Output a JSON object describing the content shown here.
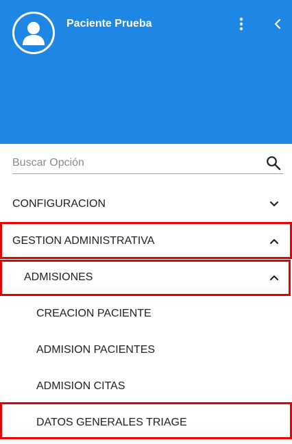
{
  "header": {
    "user_name": "Paciente Prueba",
    "background_color": "#1e86e5",
    "avatar_icon": "user-avatar-icon",
    "more_icon": "more-vertical-icon",
    "collapse_icon": "chevron-left-icon"
  },
  "search": {
    "placeholder": "Buscar Opción",
    "value": "",
    "icon": "search-icon"
  },
  "menu": {
    "configuracion": {
      "label": "CONFIGURACION",
      "state": "collapsed"
    },
    "gestion": {
      "label": "GESTION ADMINISTRATIVA",
      "state": "expanded"
    },
    "admisiones": {
      "label": "ADMISIONES",
      "state": "expanded"
    },
    "creacion_paciente": {
      "label": "CREACION PACIENTE"
    },
    "admision_pacientes": {
      "label": "ADMISION PACIENTES"
    },
    "admision_citas": {
      "label": "ADMISION CITAS"
    },
    "datos_triage": {
      "label": "DATOS GENERALES TRIAGE"
    }
  },
  "highlight_color": "#e60000"
}
